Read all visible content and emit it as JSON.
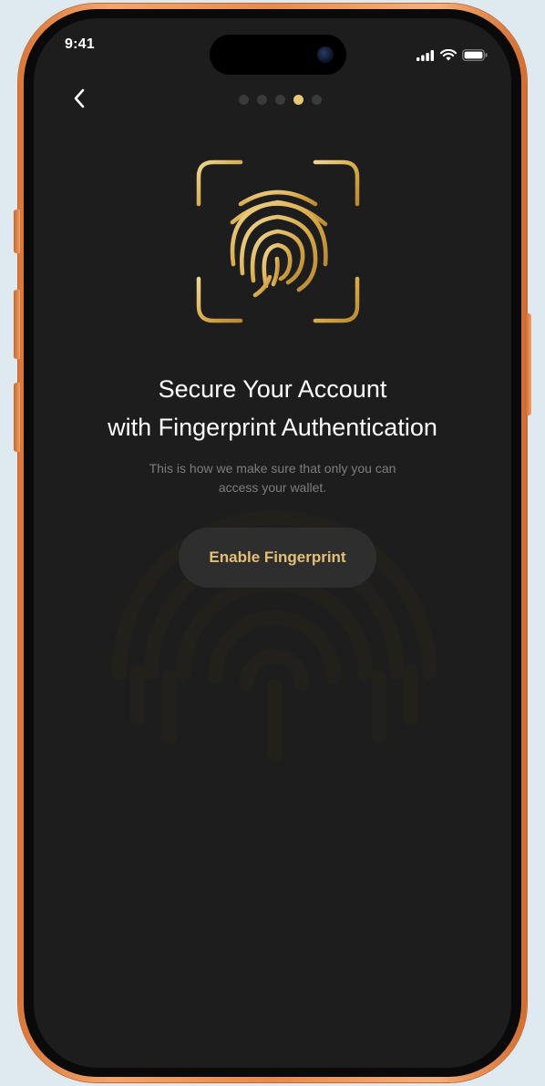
{
  "status_bar": {
    "time": "9:41",
    "icons": [
      "signal-icon",
      "wifi-icon",
      "battery-icon"
    ]
  },
  "navigation": {
    "back_icon": "chevron-left-icon",
    "pager": {
      "total": 5,
      "active": 4
    }
  },
  "illustration": {
    "icon": "fingerprint-icon",
    "frame": "scan-frame-icon"
  },
  "content": {
    "title_line1": "Secure Your Account",
    "title_line2": "with Fingerprint Authentication",
    "subtitle_line1": "This is how we make sure that only you can",
    "subtitle_line2": "access your wallet."
  },
  "actions": {
    "primary_label": "Enable Fingerprint"
  },
  "colors": {
    "accent_gold": "#e3c077",
    "screen_background": "#1d1d1d",
    "button_background": "#2e2e2e",
    "frame_orange": "#e98a4c"
  }
}
